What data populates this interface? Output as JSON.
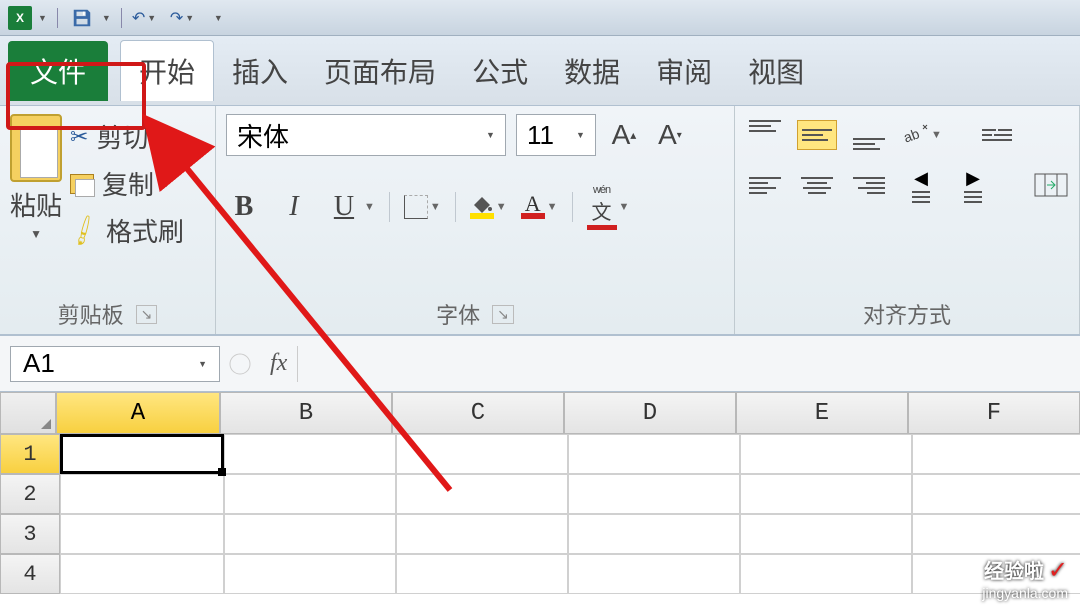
{
  "qat": {
    "excel_mark": "X"
  },
  "tabs": {
    "file": "文件",
    "home": "开始",
    "insert": "插入",
    "layout": "页面布局",
    "formula": "公式",
    "data": "数据",
    "review": "审阅",
    "view": "视图"
  },
  "clipboard": {
    "paste": "粘贴",
    "cut": "剪切",
    "copy": "复制",
    "format_painter": "格式刷",
    "group_label": "剪贴板"
  },
  "font": {
    "name": "宋体",
    "size": "11",
    "bold": "B",
    "italic": "I",
    "underline": "U",
    "wen": "wén",
    "wen_char": "文",
    "font_color_letter": "A",
    "increase": "A",
    "decrease": "A",
    "group_label": "字体"
  },
  "align": {
    "group_label": "对齐方式"
  },
  "formula_bar": {
    "name_box": "A1",
    "fx": "fx"
  },
  "columns": [
    "A",
    "B",
    "C",
    "D",
    "E",
    "F"
  ],
  "rows": [
    "1",
    "2",
    "3",
    "4"
  ],
  "watermark": {
    "brand": "经验啦",
    "url": "jingyanla.com"
  },
  "chart_data": null
}
